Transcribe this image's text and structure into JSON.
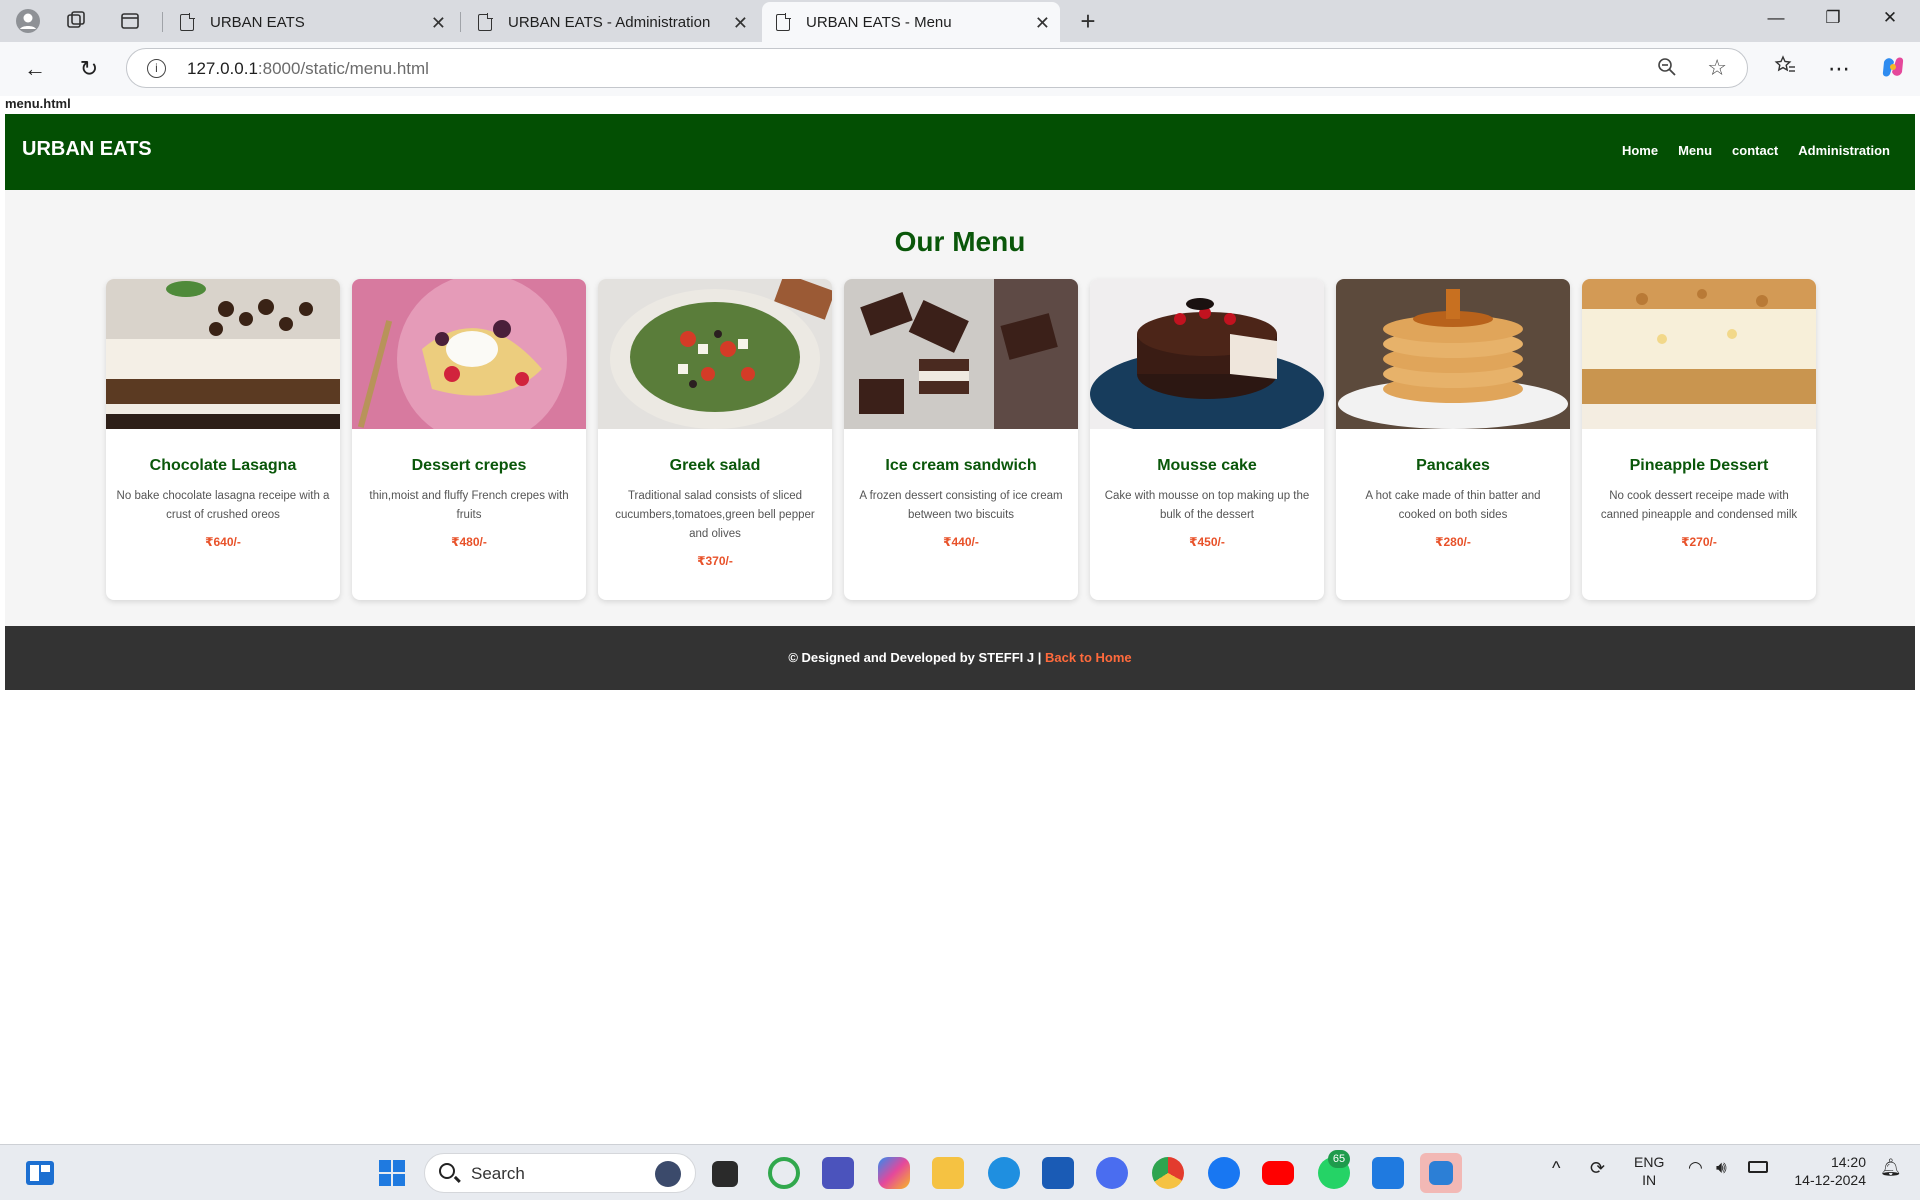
{
  "browser": {
    "tabs": [
      {
        "label": "URBAN EATS"
      },
      {
        "label": "URBAN EATS - Administration"
      },
      {
        "label": "URBAN EATS - Menu"
      }
    ],
    "url_host": "127.0.0.1",
    "url_rest": ":8000/static/menu.html",
    "status_text": "menu.html"
  },
  "site": {
    "brand": "URBAN EATS",
    "nav": [
      "Home",
      "Menu",
      "contact",
      "Administration"
    ],
    "title": "Our Menu",
    "items": [
      {
        "name": "Chocolate Lasagna",
        "desc": "No bake chocolate lasagna receipe with a crust of crushed oreos",
        "price": "₹640/-",
        "image": "chocolate-lasagna-image"
      },
      {
        "name": "Dessert crepes",
        "desc": "thin,moist and fluffy French crepes with fruits",
        "price": "₹480/-",
        "image": "dessert-crepes-image"
      },
      {
        "name": "Greek salad",
        "desc": "Traditional salad consists of sliced cucumbers,tomatoes,green bell pepper and olives",
        "price": "₹370/-",
        "image": "greek-salad-image"
      },
      {
        "name": "Ice cream sandwich",
        "desc": "A frozen dessert consisting of ice cream between two biscuits",
        "price": "₹440/-",
        "image": "ice-cream-sandwich-image"
      },
      {
        "name": "Mousse cake",
        "desc": "Cake with mousse on top making up the bulk of the dessert",
        "price": "₹450/-",
        "image": "mousse-cake-image"
      },
      {
        "name": "Pancakes",
        "desc": "A hot cake made of thin batter and cooked on both sides",
        "price": "₹280/-",
        "image": "pancakes-image"
      },
      {
        "name": "Pineapple Dessert",
        "desc": "No cook dessert receipe made with canned pineapple and condensed milk",
        "price": "₹270/-",
        "image": "pineapple-dessert-image"
      }
    ],
    "footer_text": "© Designed and Developed by STEFFI J | ",
    "footer_link": "Back to Home"
  },
  "taskbar": {
    "search_label": "Search",
    "lang_top": "ENG",
    "lang_bottom": "IN",
    "time": "14:20",
    "date": "14-12-2024",
    "whatsapp_badge": "65"
  },
  "colors": {
    "header_green": "#034f03",
    "title_green": "#0a570a",
    "price_orange": "#e8522a",
    "footer_bg": "#333333",
    "footer_link": "#ff6a3c"
  }
}
